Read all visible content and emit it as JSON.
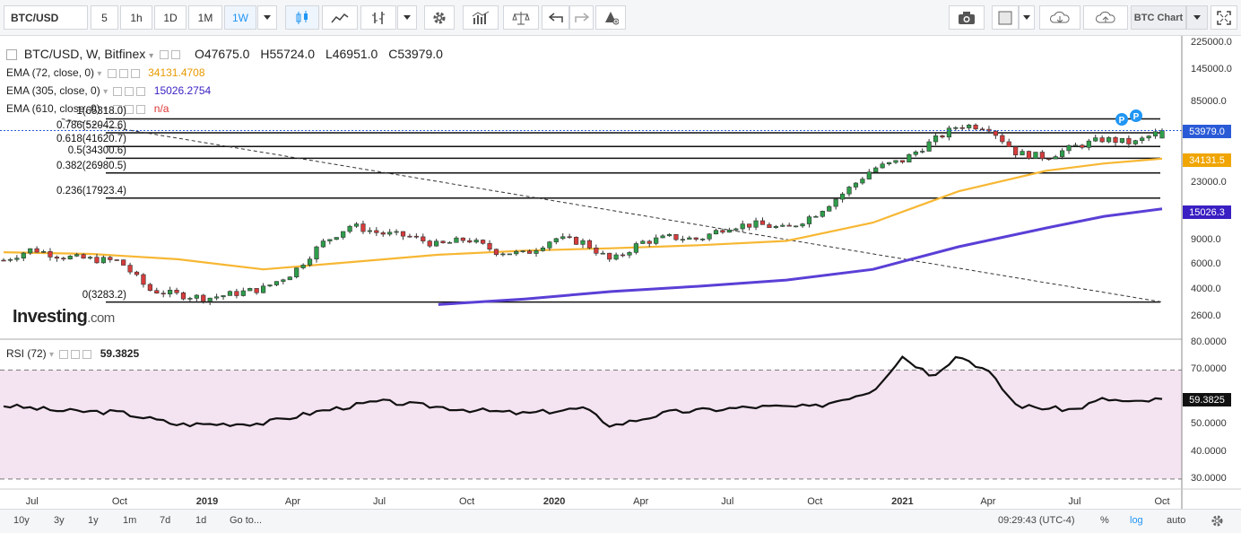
{
  "toolbar": {
    "symbol": "BTC/USD",
    "intervals": [
      "5",
      "1h",
      "1D",
      "1M",
      "1W"
    ],
    "active_interval": "1W",
    "chart_name": "BTC Chart"
  },
  "legend": {
    "title": "BTC/USD, W, Bitfinex",
    "open": "O47675.0",
    "high": "H55724.0",
    "low": "L46951.0",
    "close": "C53979.0",
    "ema72_label": "EMA (72, close, 0)",
    "ema72_value": "34131.4708",
    "ema305_label": "EMA (305, close, 0)",
    "ema305_value": "15026.2754",
    "ema610_label": "EMA (610, close, 0)",
    "ema610_value": "n/a",
    "rsi_label": "RSI (72)",
    "rsi_value": "59.3825",
    "watermark": "Investing",
    "watermark_suffix": ".com"
  },
  "fib_levels": [
    {
      "label": "1(65318.0)",
      "value": 65318.0
    },
    {
      "label": "0.786(52042.6)",
      "value": 52042.6
    },
    {
      "label": "0.618(41620.7)",
      "value": 41620.7
    },
    {
      "label": "0.5(34300.6)",
      "value": 34300.6
    },
    {
      "label": "0.382(26980.5)",
      "value": 26980.5
    },
    {
      "label": "0.236(17923.4)",
      "value": 17923.4
    },
    {
      "label": "0(3283.2)",
      "value": 3283.2
    }
  ],
  "price_axis": {
    "ticks": [
      "225000.0",
      "145000.0",
      "85000.0",
      "53979.0",
      "23000.0",
      "15026.3",
      "9000.0",
      "6000.0",
      "4000.0",
      "2600.0",
      "34131.5"
    ],
    "tick_values": [
      225000,
      145000,
      85000,
      23000,
      9000,
      6000,
      4000,
      2600
    ],
    "last_price_tag": "53979.0",
    "ema72_tag": "34131.5",
    "ema305_tag": "15026.3"
  },
  "rsi_axis": {
    "ticks": [
      "80.0000",
      "70.0000",
      "50.0000",
      "40.0000",
      "30.0000"
    ],
    "tick_values": [
      80,
      70,
      50,
      40,
      30
    ],
    "tag": "59.3825"
  },
  "x_axis": {
    "ticks": [
      {
        "label": "Jul",
        "bold": false
      },
      {
        "label": "Oct",
        "bold": false
      },
      {
        "label": "2019",
        "bold": true
      },
      {
        "label": "Apr",
        "bold": false
      },
      {
        "label": "Jul",
        "bold": false
      },
      {
        "label": "Oct",
        "bold": false
      },
      {
        "label": "2020",
        "bold": true
      },
      {
        "label": "Apr",
        "bold": false
      },
      {
        "label": "Jul",
        "bold": false
      },
      {
        "label": "Oct",
        "bold": false
      },
      {
        "label": "2021",
        "bold": true
      },
      {
        "label": "Apr",
        "bold": false
      },
      {
        "label": "Jul",
        "bold": false
      },
      {
        "label": "Oct",
        "bold": false
      }
    ]
  },
  "bottombar": {
    "ranges": [
      "10y",
      "3y",
      "1y",
      "1m",
      "7d",
      "1d"
    ],
    "goto": "Go to...",
    "time": "09:29:43 (UTC-4)",
    "pct": "%",
    "log": "log",
    "auto": "auto"
  },
  "colors": {
    "up": "#2e9e4a",
    "down": "#d83c3c",
    "ema72": "#f7b733",
    "ema305": "#5b3fd6",
    "last_price": "#2a5bd7",
    "rsi_band": "#f4e3f1",
    "accent": "#2196f3"
  },
  "chart_data": [
    {
      "type": "candlestick",
      "title": "BTC/USD, W, Bitfinex",
      "scale": "log",
      "ylim": [
        2400,
        225000
      ],
      "x_start": "2018-06",
      "x_end": "2021-10",
      "ohlc_last": {
        "open": 47675.0,
        "high": 55724.0,
        "low": 46951.0,
        "close": 53979.0
      },
      "close_path": [
        {
          "date": "2018-06",
          "close": 6500
        },
        {
          "date": "2018-07",
          "close": 7800
        },
        {
          "date": "2018-08",
          "close": 6900
        },
        {
          "date": "2018-09",
          "close": 6600
        },
        {
          "date": "2018-10",
          "close": 6400
        },
        {
          "date": "2018-11",
          "close": 4000
        },
        {
          "date": "2018-12",
          "close": 3700
        },
        {
          "date": "2019-01",
          "close": 3500
        },
        {
          "date": "2019-02",
          "close": 3800
        },
        {
          "date": "2019-03",
          "close": 4100
        },
        {
          "date": "2019-04",
          "close": 5300
        },
        {
          "date": "2019-05",
          "close": 8500
        },
        {
          "date": "2019-06",
          "close": 11500
        },
        {
          "date": "2019-07",
          "close": 10100
        },
        {
          "date": "2019-08",
          "close": 9600
        },
        {
          "date": "2019-09",
          "close": 8300
        },
        {
          "date": "2019-10",
          "close": 9200
        },
        {
          "date": "2019-11",
          "close": 7500
        },
        {
          "date": "2019-12",
          "close": 7200
        },
        {
          "date": "2020-01",
          "close": 9300
        },
        {
          "date": "2020-02",
          "close": 8700
        },
        {
          "date": "2020-03",
          "close": 6400
        },
        {
          "date": "2020-04",
          "close": 8700
        },
        {
          "date": "2020-05",
          "close": 9450
        },
        {
          "date": "2020-06",
          "close": 9150
        },
        {
          "date": "2020-07",
          "close": 11300
        },
        {
          "date": "2020-08",
          "close": 11700
        },
        {
          "date": "2020-09",
          "close": 10800
        },
        {
          "date": "2020-10",
          "close": 13800
        },
        {
          "date": "2020-11",
          "close": 19700
        },
        {
          "date": "2020-12",
          "close": 29000
        },
        {
          "date": "2021-01",
          "close": 33100
        },
        {
          "date": "2021-02",
          "close": 45200
        },
        {
          "date": "2021-03",
          "close": 58800
        },
        {
          "date": "2021-04",
          "close": 57700
        },
        {
          "date": "2021-05",
          "close": 37300
        },
        {
          "date": "2021-06",
          "close": 35000
        },
        {
          "date": "2021-07",
          "close": 41500
        },
        {
          "date": "2021-08",
          "close": 47100
        },
        {
          "date": "2021-09",
          "close": 43800
        },
        {
          "date": "2021-10",
          "close": 53979
        }
      ],
      "series": [
        {
          "name": "EMA (72, close, 0)",
          "last": 34131.4708,
          "values": [
            {
              "date": "2018-06",
              "value": 7400
            },
            {
              "date": "2018-09",
              "value": 7200
            },
            {
              "date": "2018-12",
              "value": 6600
            },
            {
              "date": "2019-03",
              "value": 5600
            },
            {
              "date": "2019-06",
              "value": 6300
            },
            {
              "date": "2019-09",
              "value": 7100
            },
            {
              "date": "2019-12",
              "value": 7600
            },
            {
              "date": "2020-03",
              "value": 7900
            },
            {
              "date": "2020-06",
              "value": 8300
            },
            {
              "date": "2020-09",
              "value": 8900
            },
            {
              "date": "2020-12",
              "value": 12000
            },
            {
              "date": "2021-03",
              "value": 20000
            },
            {
              "date": "2021-06",
              "value": 28000
            },
            {
              "date": "2021-08",
              "value": 31500
            },
            {
              "date": "2021-10",
              "value": 34131
            }
          ]
        },
        {
          "name": "EMA (305, close, 0)",
          "last": 15026.2754,
          "values": [
            {
              "date": "2019-09",
              "value": 3150
            },
            {
              "date": "2019-12",
              "value": 3450
            },
            {
              "date": "2020-03",
              "value": 3900
            },
            {
              "date": "2020-06",
              "value": 4250
            },
            {
              "date": "2020-09",
              "value": 4700
            },
            {
              "date": "2020-12",
              "value": 5600
            },
            {
              "date": "2021-03",
              "value": 8100
            },
            {
              "date": "2021-06",
              "value": 11000
            },
            {
              "date": "2021-08",
              "value": 13300
            },
            {
              "date": "2021-10",
              "value": 15026
            }
          ]
        }
      ],
      "fibonacci": [
        65318.0,
        52042.6,
        41620.7,
        34300.6,
        26980.5,
        17923.4,
        3283.2
      ],
      "trendline": [
        {
          "date": "2018-08",
          "value": 65318
        },
        {
          "date": "2021-10",
          "value": 3283.2
        }
      ]
    },
    {
      "type": "line",
      "title": "RSI (72)",
      "ylim": [
        28,
        80
      ],
      "bands": [
        30,
        70
      ],
      "last": 59.3825,
      "values": [
        {
          "date": "2018-06",
          "value": 57
        },
        {
          "date": "2018-08",
          "value": 55
        },
        {
          "date": "2018-10",
          "value": 54.5
        },
        {
          "date": "2018-12",
          "value": 50
        },
        {
          "date": "2019-03",
          "value": 50.5
        },
        {
          "date": "2019-05",
          "value": 55
        },
        {
          "date": "2019-07",
          "value": 58.5
        },
        {
          "date": "2019-10",
          "value": 55.5
        },
        {
          "date": "2019-12",
          "value": 54
        },
        {
          "date": "2020-02",
          "value": 56
        },
        {
          "date": "2020-03",
          "value": 49.5
        },
        {
          "date": "2020-05",
          "value": 54.5
        },
        {
          "date": "2020-08",
          "value": 56.5
        },
        {
          "date": "2020-10",
          "value": 56.5
        },
        {
          "date": "2020-12",
          "value": 62.5
        },
        {
          "date": "2021-01",
          "value": 75
        },
        {
          "date": "2021-02",
          "value": 68
        },
        {
          "date": "2021-03",
          "value": 75.5
        },
        {
          "date": "2021-04",
          "value": 69.5
        },
        {
          "date": "2021-05",
          "value": 57
        },
        {
          "date": "2021-06",
          "value": 56
        },
        {
          "date": "2021-07",
          "value": 55.5
        },
        {
          "date": "2021-08",
          "value": 59.5
        },
        {
          "date": "2021-09",
          "value": 58
        },
        {
          "date": "2021-10",
          "value": 59.3825
        }
      ]
    }
  ]
}
